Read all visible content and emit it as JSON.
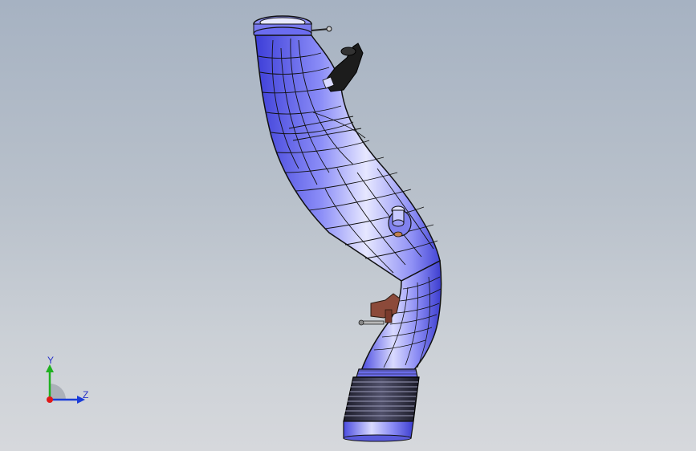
{
  "viewport": {
    "background_top": "#a6b2c2",
    "background_bottom": "#d6d8dc"
  },
  "model": {
    "name": "air-intake-duct",
    "body_color": "#6b6cf2",
    "edge_color": "#000000",
    "bellows_color": "#2a2a3a",
    "bracket_color": "#1c1c1c",
    "clip_color": "#8c4a3a"
  },
  "triad": {
    "y_label": "Y",
    "z_label": "Z",
    "y_color": "#1fb11f",
    "z_color": "#1a3cd8",
    "x_color": "#e01818"
  }
}
